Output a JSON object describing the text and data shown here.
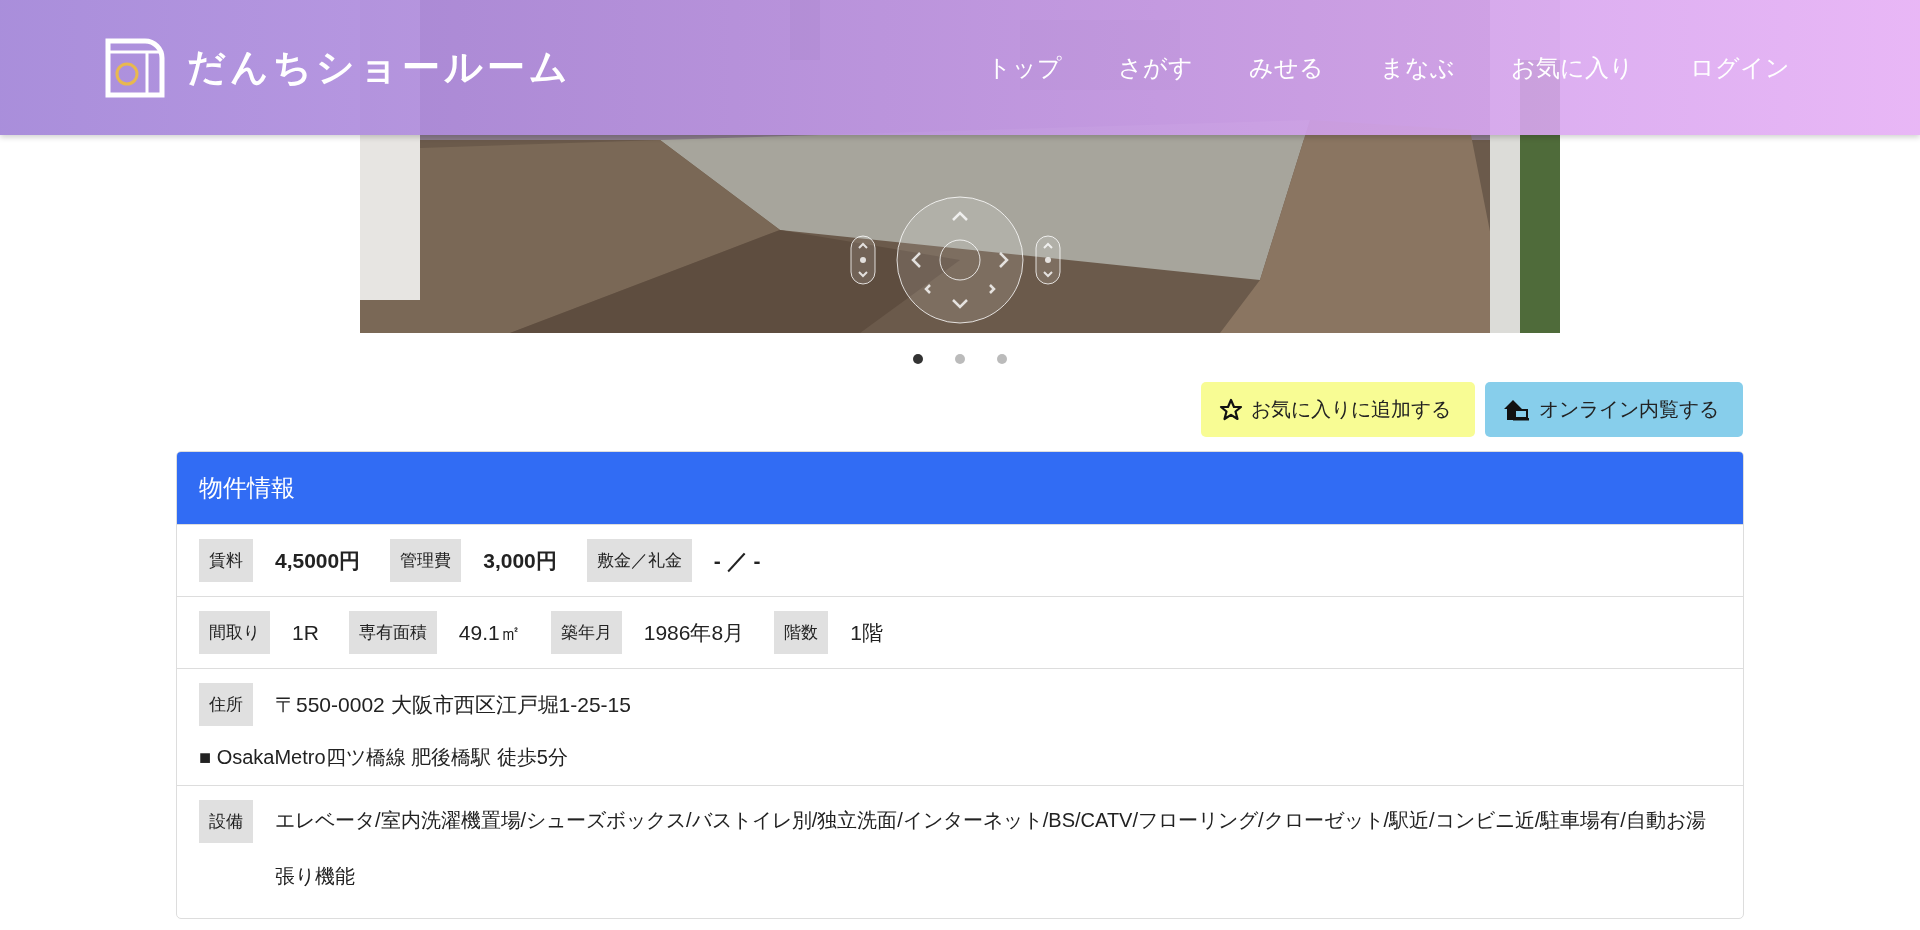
{
  "header": {
    "logo": "だんちショールーム",
    "nav": [
      {
        "label": "トップ"
      },
      {
        "label": "さがす"
      },
      {
        "label": "みせる"
      },
      {
        "label": "まなぶ"
      },
      {
        "label": "お気に入り"
      },
      {
        "label": "ログイン"
      }
    ]
  },
  "viewer": {
    "kind": "picture",
    "slides": [
      {
        "selected": true
      },
      {
        "selected": false
      },
      {
        "selected": false
      }
    ]
  },
  "actions": [
    {
      "kind": "favorite",
      "label": "お気に入りに追加する"
    },
    {
      "kind": "tour",
      "label": "オンライン内覧する"
    }
  ],
  "property": {
    "title": "物件情報",
    "rows": [
      {
        "kind": "fields",
        "bold": true,
        "items": [
          {
            "label": "賃料",
            "value": "4,5000円"
          },
          {
            "label": "管理費",
            "value": "3,000円"
          },
          {
            "label": "敷金／礼金",
            "value": "- ／ -"
          }
        ]
      },
      {
        "kind": "fields",
        "bold": false,
        "items": [
          {
            "label": "間取り",
            "value": "1R"
          },
          {
            "label": "専有面積",
            "value": "49.1㎡"
          },
          {
            "label": "築年月",
            "value": "1986年8月"
          },
          {
            "label": "階数",
            "value": "1階"
          }
        ]
      },
      {
        "kind": "address",
        "label": "住所",
        "value": "〒550-0002 大阪市西区江戸堀1-25-15",
        "note": "■ OsakaMetro四ツ橋線 肥後橋駅 徒歩5分"
      },
      {
        "kind": "text",
        "label": "設備",
        "value": "エレベータ/室内洗濯機置場/シューズボックス/バストイレ別/独立洗面/インターネット/BS/CATV/フローリング/クローゼット/駅近/コンビニ近/駐車場有/自動お湯張り機能"
      }
    ]
  }
}
